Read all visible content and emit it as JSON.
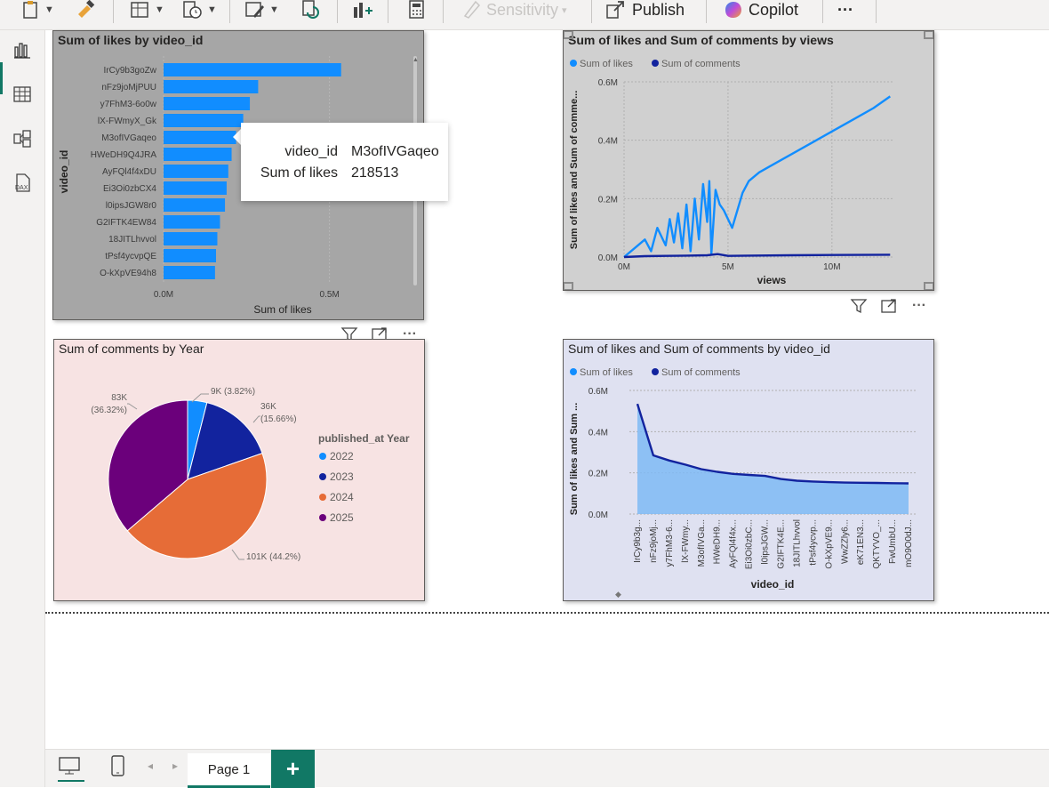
{
  "ribbon": {
    "sensitivity_label": "Sensitivity",
    "publish_label": "Publish",
    "copilot_label": "Copilot",
    "more_label": "···"
  },
  "rail": {
    "items": [
      "report-view",
      "table-view",
      "model-view",
      "dax-query-view"
    ],
    "dax_label": "DAX"
  },
  "colors": {
    "light_blue": "#118dff",
    "dark_blue": "#12239e",
    "orange": "#e66c37",
    "purple": "#6b007b",
    "accent": "#117865"
  },
  "visuals": {
    "likes_bar": {
      "title": "Sum of likes by video_id",
      "background": "#a6a6a6"
    },
    "views_line": {
      "title": "Sum of likes and Sum of comments by views",
      "background": "#d0d0d0"
    },
    "year_pie": {
      "title": "Sum of comments by Year",
      "background": "#f7e3e3"
    },
    "video_area": {
      "title": "Sum of likes and Sum of comments by video_id",
      "background": "#dfe1f1"
    }
  },
  "tooltip": {
    "rows": [
      {
        "key": "video_id",
        "value": "M3ofIVGaqeo"
      },
      {
        "key": "Sum of likes",
        "value": "218513"
      }
    ]
  },
  "chart_data": [
    {
      "type": "bar",
      "orientation": "horizontal",
      "title": "Sum of likes by video_id",
      "xlabel": "Sum of likes",
      "ylabel": "video_id",
      "categories": [
        "IrCy9b3goZw",
        "nFz9joMjPUU",
        "y7FhM3-6o0w",
        "lX-FWmyX_Gk",
        "M3ofIVGaqeo",
        "HWeDH9Q4JRA",
        "AyFQl4f4xDU",
        "Ei3Oi0zbCX4",
        "l0ipsJGW8r0",
        "G2IFTK4EW84",
        "18JITLhvvol",
        "tPsf4ycvpQE",
        "O-kXpVE94h8"
      ],
      "values": [
        535000,
        285000,
        260000,
        240000,
        218513,
        205000,
        195000,
        190000,
        185000,
        170000,
        162000,
        158000,
        155000
      ],
      "xticks": [
        "0.0M",
        "0.5M"
      ],
      "xlim": [
        0,
        600000
      ],
      "color": "#118dff"
    },
    {
      "type": "line",
      "title": "Sum of likes and Sum of comments by views",
      "xlabel": "views",
      "ylabel": "Sum of likes and Sum of comme...",
      "xticks": [
        "0M",
        "5M",
        "10M"
      ],
      "yticks": [
        "0.0M",
        "0.2M",
        "0.4M",
        "0.6M"
      ],
      "xlim": [
        0,
        13000000
      ],
      "ylim": [
        0,
        0.6
      ],
      "legend": "top-left",
      "series": [
        {
          "name": "Sum of likes",
          "color": "#118dff",
          "x": [
            0,
            0.5,
            1,
            1.3,
            1.6,
            2,
            2.2,
            2.4,
            2.6,
            2.8,
            3,
            3.2,
            3.4,
            3.6,
            3.8,
            4,
            4.1,
            4.2,
            4.4,
            4.6,
            4.8,
            5.2,
            5.7,
            6,
            6.5,
            7,
            8,
            9,
            10,
            11,
            12,
            12.8
          ],
          "y": [
            0,
            0.03,
            0.06,
            0.02,
            0.1,
            0.04,
            0.13,
            0.05,
            0.15,
            0.03,
            0.18,
            0.02,
            0.2,
            0.06,
            0.25,
            0.12,
            0.26,
            0.01,
            0.23,
            0.18,
            0.16,
            0.1,
            0.22,
            0.26,
            0.29,
            0.31,
            0.35,
            0.39,
            0.43,
            0.47,
            0.51,
            0.55
          ]
        },
        {
          "name": "Sum of comments",
          "color": "#12239e",
          "x": [
            0,
            1,
            2,
            3,
            4,
            4.5,
            5,
            6,
            8,
            10,
            12.8
          ],
          "y": [
            0,
            0.003,
            0.004,
            0.005,
            0.006,
            0.01,
            0.004,
            0.005,
            0.006,
            0.007,
            0.008
          ]
        }
      ]
    },
    {
      "type": "pie",
      "title": "Sum of comments by Year",
      "legend_title": "published_at Year",
      "legend": "right",
      "categories": [
        "2022",
        "2023",
        "2024",
        "2025"
      ],
      "values": [
        9000,
        36000,
        101000,
        83000
      ],
      "percents": [
        3.82,
        15.66,
        44.2,
        36.32
      ],
      "labels": [
        "9K (3.82%)",
        "36K (15.66%)",
        "101K (44.2%)",
        "83K (36.32%)"
      ],
      "colors": [
        "#118dff",
        "#12239e",
        "#e66c37",
        "#6b007b"
      ]
    },
    {
      "type": "area",
      "title": "Sum of likes and Sum of comments by video_id",
      "xlabel": "video_id",
      "ylabel": "Sum of likes and Sum ...",
      "legend": "top-left",
      "categories": [
        "IrCy9b3g...",
        "nFz9joMj...",
        "y7FhM3-6...",
        "lX-FWmy...",
        "M3ofIVGa...",
        "HWeDH9...",
        "AyFQl4f4x...",
        "Ei3Oi0zbC...",
        "l0ipsJGW...",
        "G2IFTK4E...",
        "18JITLhvvol",
        "tPsf4ycvp...",
        "O-kXpVE9...",
        "WwZZly6...",
        "eK71EN3...",
        "QKTYVO_...",
        "FwUmbU...",
        "mO9O0dJ..."
      ],
      "yticks": [
        "0.0M",
        "0.2M",
        "0.4M",
        "0.6M"
      ],
      "ylim": [
        0,
        0.6
      ],
      "series": [
        {
          "name": "Sum of likes",
          "color": "#118dff",
          "values": [
            0.535,
            0.285,
            0.26,
            0.24,
            0.218,
            0.205,
            0.195,
            0.19,
            0.185,
            0.17,
            0.162,
            0.158,
            0.155,
            0.153,
            0.152,
            0.151,
            0.15,
            0.149
          ]
        },
        {
          "name": "Sum of comments",
          "color": "#12239e",
          "values": [
            0.535,
            0.285,
            0.26,
            0.24,
            0.218,
            0.205,
            0.195,
            0.19,
            0.185,
            0.17,
            0.162,
            0.158,
            0.155,
            0.153,
            0.152,
            0.151,
            0.15,
            0.149
          ]
        }
      ]
    }
  ],
  "bottombar": {
    "page_label": "Page 1",
    "add_label": "+"
  }
}
